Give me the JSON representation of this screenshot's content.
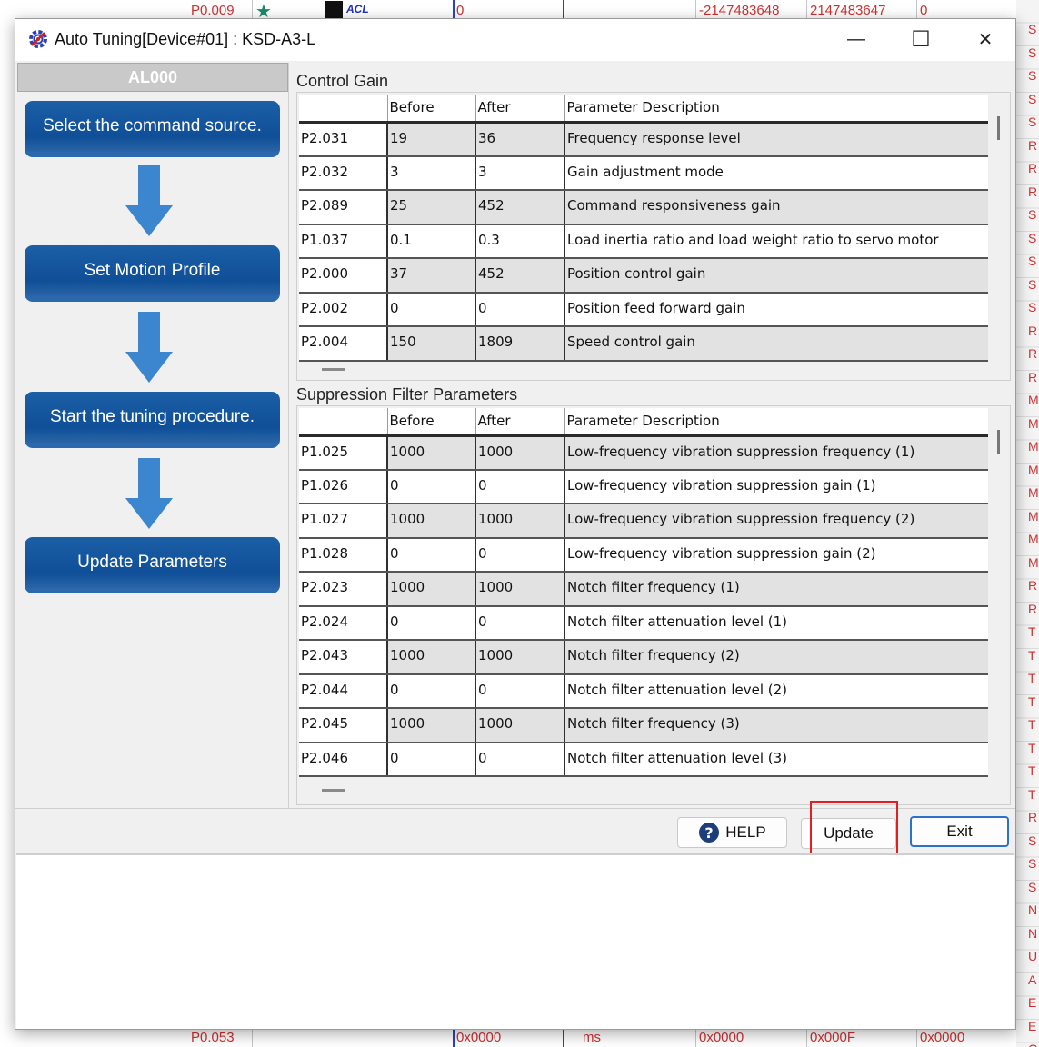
{
  "background": {
    "top_row": [
      "P0.009",
      "0",
      "-2147483648",
      "2147483647",
      "0"
    ],
    "bottom_row": [
      "P0.053",
      "0x0000",
      "ms",
      "0x0000",
      "0x000F",
      "0x0000"
    ],
    "right_letters": [
      "S",
      "S",
      "S",
      "S",
      "S",
      "R",
      "R",
      "R",
      "S",
      "S",
      "S",
      "S",
      "S",
      "R",
      "R",
      "R",
      "M",
      "M",
      "M",
      "M",
      "M",
      "M",
      "M",
      "M",
      "R",
      "R",
      "T",
      "T",
      "T",
      "T",
      "T",
      "T",
      "T",
      "T",
      "R",
      "S",
      "S",
      "S",
      "N",
      "N",
      "U",
      "A",
      "E",
      "E",
      "G"
    ]
  },
  "window": {
    "title": "Auto Tuning[Device#01] : KSD-A3-L",
    "minimize": "—",
    "maximize": "☐",
    "close": "✕"
  },
  "left_panel": {
    "alarm_code": "AL000",
    "steps": [
      "Select the command source.",
      "Set Motion Profile",
      "Start the tuning procedure.",
      "Update Parameters"
    ]
  },
  "control_gain": {
    "title": "Control Gain",
    "columns": [
      "",
      "Before",
      "After",
      "Parameter Description"
    ],
    "rows": [
      {
        "code": "P2.031",
        "before": "19",
        "after": "36",
        "desc": "Frequency response level"
      },
      {
        "code": "P2.032",
        "before": "3",
        "after": "3",
        "desc": "Gain adjustment mode"
      },
      {
        "code": "P2.089",
        "before": "25",
        "after": "452",
        "desc": "Command responsiveness gain"
      },
      {
        "code": "P1.037",
        "before": "0.1",
        "after": "0.3",
        "desc": "Load inertia ratio and load weight ratio to servo motor"
      },
      {
        "code": "P2.000",
        "before": "37",
        "after": "452",
        "desc": "Position control gain"
      },
      {
        "code": "P2.002",
        "before": "0",
        "after": "0",
        "desc": "Position feed forward gain"
      },
      {
        "code": "P2.004",
        "before": "150",
        "after": "1809",
        "desc": "Speed control gain"
      }
    ]
  },
  "suppression_filter": {
    "title": "Suppression Filter Parameters",
    "columns": [
      "",
      "Before",
      "After",
      "Parameter Description"
    ],
    "rows": [
      {
        "code": "P1.025",
        "before": "1000",
        "after": "1000",
        "desc": "Low-frequency vibration suppression frequency (1)"
      },
      {
        "code": "P1.026",
        "before": "0",
        "after": "0",
        "desc": "Low-frequency vibration suppression gain (1)"
      },
      {
        "code": "P1.027",
        "before": "1000",
        "after": "1000",
        "desc": "Low-frequency vibration suppression frequency (2)"
      },
      {
        "code": "P1.028",
        "before": "0",
        "after": "0",
        "desc": "Low-frequency vibration suppression gain (2)"
      },
      {
        "code": "P2.023",
        "before": "1000",
        "after": "1000",
        "desc": "Notch filter frequency (1)"
      },
      {
        "code": "P2.024",
        "before": "0",
        "after": "0",
        "desc": "Notch filter attenuation level (1)"
      },
      {
        "code": "P2.043",
        "before": "1000",
        "after": "1000",
        "desc": "Notch filter frequency (2)"
      },
      {
        "code": "P2.044",
        "before": "0",
        "after": "0",
        "desc": "Notch filter attenuation level (2)"
      },
      {
        "code": "P2.045",
        "before": "1000",
        "after": "1000",
        "desc": "Notch filter frequency (3)"
      },
      {
        "code": "P2.046",
        "before": "0",
        "after": "0",
        "desc": "Notch filter attenuation level (3)"
      }
    ]
  },
  "buttons": {
    "help": "HELP",
    "update": "Update",
    "exit": "Exit"
  },
  "colors": {
    "step_button": "#0f4f98",
    "arrow": "#3b86cf",
    "highlight": "#e02020",
    "exit_border": "#2b73c8"
  }
}
